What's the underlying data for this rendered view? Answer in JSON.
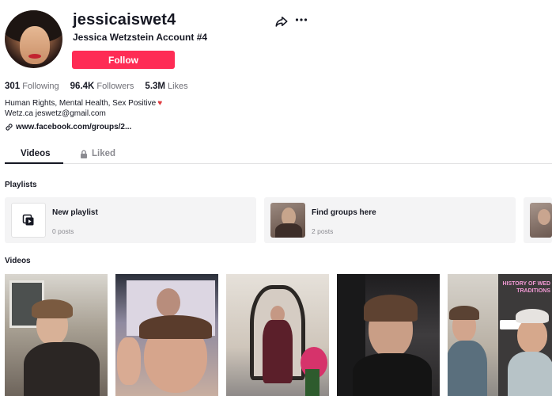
{
  "profile": {
    "handle": "jessicaiswet4",
    "full_name": "Jessica Wetzstein Account #4",
    "follow_label": "Follow"
  },
  "stats": [
    {
      "value": "301",
      "label": "Following"
    },
    {
      "value": "96.4K",
      "label": "Followers"
    },
    {
      "value": "5.3M",
      "label": "Likes"
    }
  ],
  "bio": {
    "line1": "Human Rights, Mental Health, Sex Positive",
    "line2": "Wetz.ca jeswetz@gmail.com",
    "link": "www.facebook.com/groups/2..."
  },
  "tabs": [
    {
      "label": "Videos",
      "active": true
    },
    {
      "label": "Liked",
      "active": false,
      "icon": "lock-icon"
    }
  ],
  "sections": {
    "playlists_title": "Playlists",
    "videos_title": "Videos"
  },
  "playlists": [
    {
      "name": "New playlist",
      "count": "0 posts",
      "icon": "playlist-icon"
    },
    {
      "name": "Find groups here",
      "count": "2 posts"
    }
  ],
  "videos": [
    {
      "thumb_tone": "#8b7a6a"
    },
    {
      "thumb_tone": "#b9a9a6"
    },
    {
      "thumb_tone": "#8f8377"
    },
    {
      "thumb_tone": "#4b4646"
    },
    {
      "thumb_tone": "#c8b8a6",
      "overlay_text": "HISTORY OF WED TRADITIONS"
    }
  ],
  "colors": {
    "accent": "#fe2c55",
    "heart": "#e03a3e"
  }
}
